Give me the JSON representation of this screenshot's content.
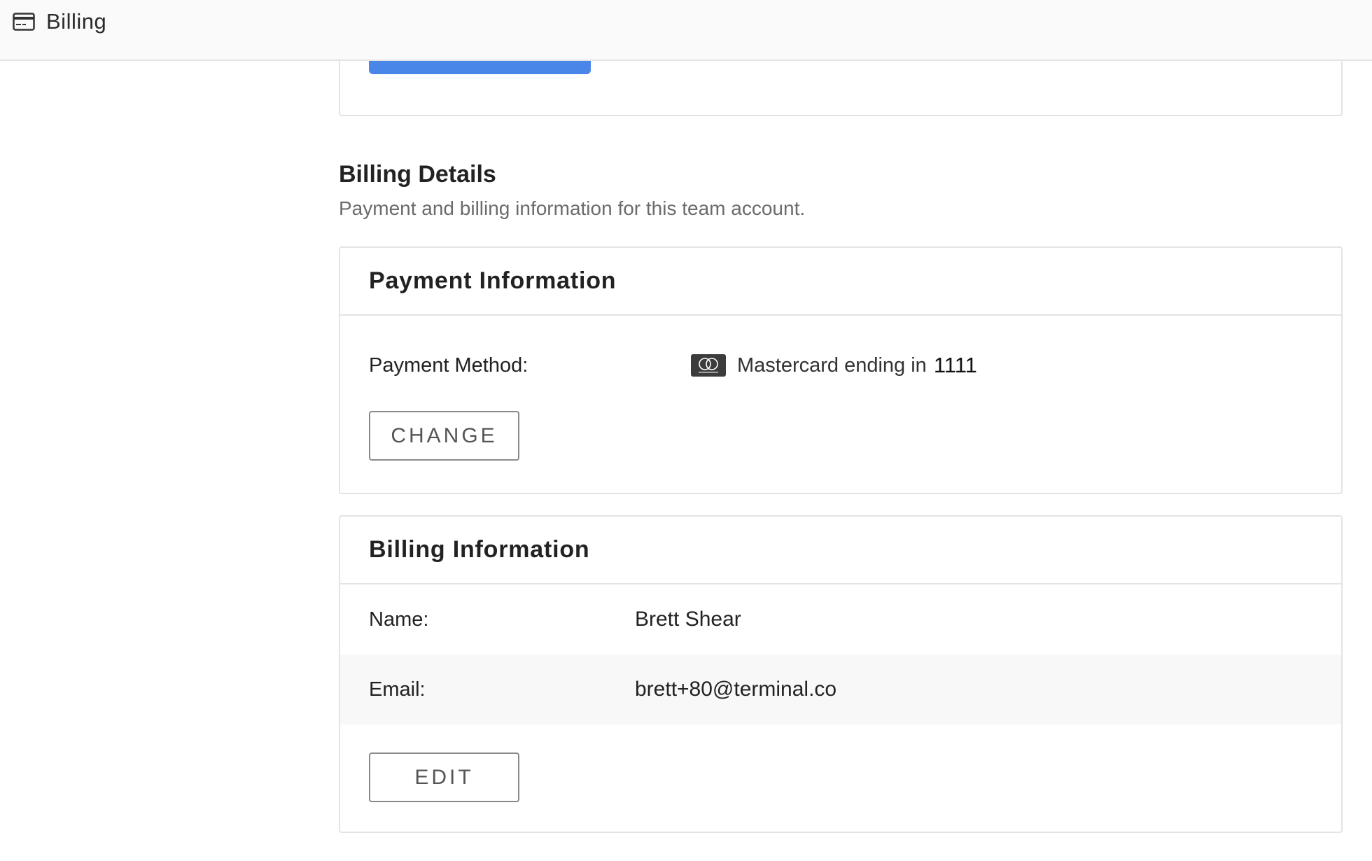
{
  "header": {
    "title": "Billing",
    "icon": "credit-card-icon"
  },
  "details": {
    "title": "Billing Details",
    "subtitle": "Payment and billing information for this team account."
  },
  "payment": {
    "title": "Payment Information",
    "method_label": "Payment Method:",
    "card_icon": "mastercard-icon",
    "card_text": "Mastercard ending in",
    "last4": "1111",
    "change_label": "CHANGE"
  },
  "billing": {
    "title": "Billing Information",
    "rows": [
      {
        "label": "Name:",
        "value": "Brett Shear"
      },
      {
        "label": "Email:",
        "value": "brett+80@terminal.co"
      }
    ],
    "edit_label": "EDIT"
  },
  "colors": {
    "accent": "#4a86e8",
    "border": "#e4e4e4",
    "muted_text": "#6b6b6b"
  }
}
